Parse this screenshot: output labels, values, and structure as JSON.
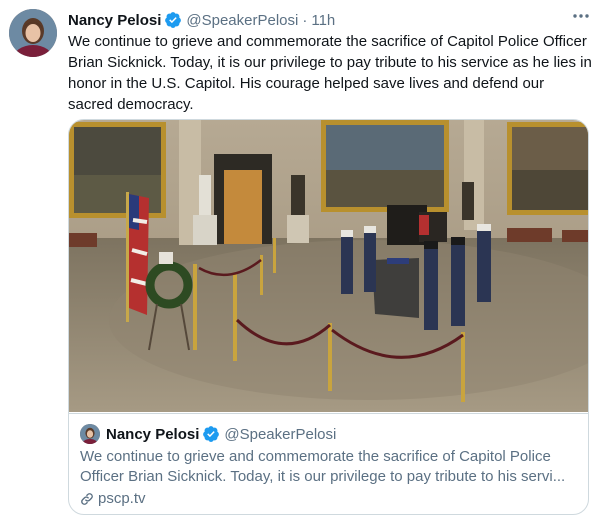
{
  "tweet": {
    "author_name": "Nancy Pelosi",
    "handle": "@SpeakerPelosi",
    "separator": "·",
    "time": "11h",
    "text": "We continue to grieve and commemorate the sacrifice of Capitol Police Officer Brian Sicknick. Today, it is our privilege to pay tribute to his service as he lies in honor in the U.S. Capitol. His courage helped save lives and defend our sacred democracy."
  },
  "card": {
    "author_name": "Nancy Pelosi",
    "handle": "@SpeakerPelosi",
    "text_line1": "We continue to grieve and commemorate the sacrifice of Capitol Police",
    "text_line2": "Officer Brian Sicknick. Today, it is our privilege to pay tribute to his servi...",
    "link": "pscp.tv"
  },
  "icons": {
    "verified": "verified-badge-icon",
    "more": "more-options-icon",
    "link": "link-icon"
  },
  "colors": {
    "verified_blue": "#1d9bf0",
    "secondary_text": "#5b7083",
    "border": "#cfd9de"
  }
}
